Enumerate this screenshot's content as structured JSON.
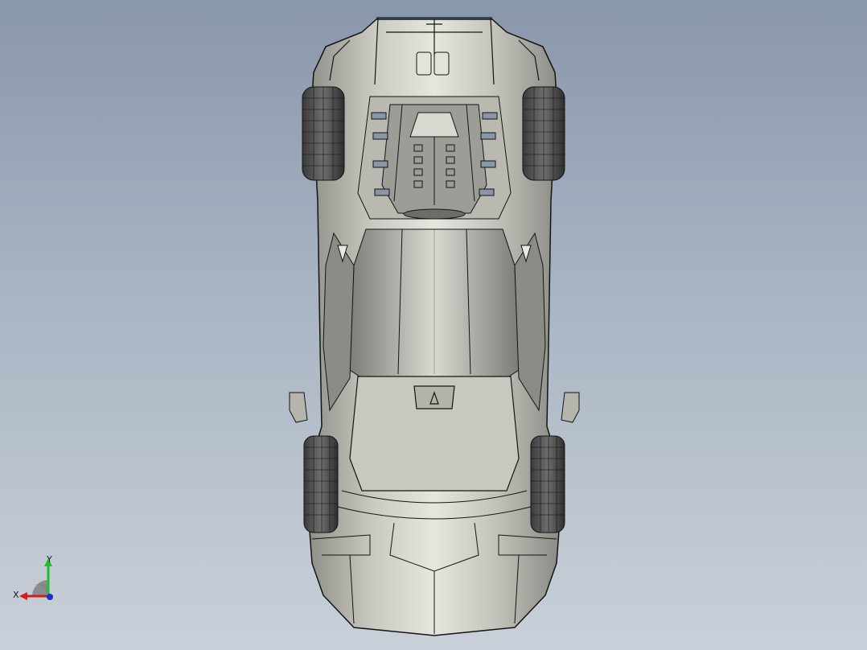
{
  "viewport": {
    "background_top": "#8997aa",
    "background_bottom": "#c9d0d9"
  },
  "model": {
    "body_color": "#b4b4aa",
    "outline_color": "#141414",
    "glass_color": "#8a95a8"
  },
  "triad": {
    "y_label": "Y",
    "x_label": "X",
    "y_color": "#1fbf2a",
    "x_color": "#d81b1b",
    "z_color": "#1a2bd8"
  }
}
